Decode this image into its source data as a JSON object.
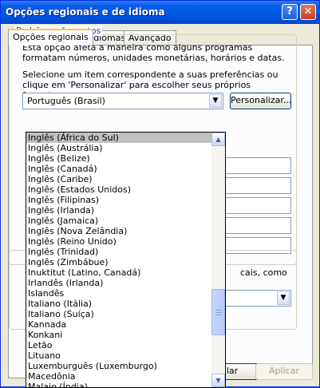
{
  "window": {
    "title": "Opções regionais e de idioma",
    "help_label": "?",
    "close_label": "✕"
  },
  "tabs": [
    {
      "label": "Opções regionais"
    },
    {
      "label": "Idiomas"
    },
    {
      "label": "Avançado"
    }
  ],
  "group": {
    "title": "Padrões e formatos",
    "description": "Esta opção afeta a maneira como alguns programas formatam números, unidades monetárias, horários e datas.",
    "instructions": "Selecione um item correspondente a suas preferências ou clique em 'Personalizar' para escolher seus próprios formatos:",
    "selected_value": "Português (Brasil)",
    "customize_label": "Personalizar..."
  },
  "group2": {
    "text": "cais, como"
  },
  "dropdown": {
    "selected_index": 0,
    "items": [
      "Inglês (África do Sul)",
      "Inglês (Austrália)",
      "Inglês (Belize)",
      "Inglês (Canadá)",
      "Inglês (Caribe)",
      "Inglês (Estados Unidos)",
      "Inglês (Filipinas)",
      "Inglês (Irlanda)",
      "Inglês (Jamaica)",
      "Inglês (Nova Zelândia)",
      "Inglês (Reino Unido)",
      "Inglês (Trinidad)",
      "Inglês (Zimbábue)",
      "Inuktitut (Latino, Canadá)",
      "Irlandês (Irlanda)",
      "Islandês",
      "Italiano (Itália)",
      "Italiano (Suíça)",
      "Kannada",
      "Konkani",
      "Letão",
      "Lituano",
      "Luxemburguês (Luxemburgo)",
      "Macedônia",
      "Malaio (Índia)"
    ]
  },
  "buttons": {
    "cancel_partial": "lar",
    "apply": "Aplicar"
  },
  "icons": {
    "combo_arrow": "chevron-down-icon",
    "scroll_up": "up-arrow-icon",
    "scroll_down": "down-arrow-icon"
  }
}
